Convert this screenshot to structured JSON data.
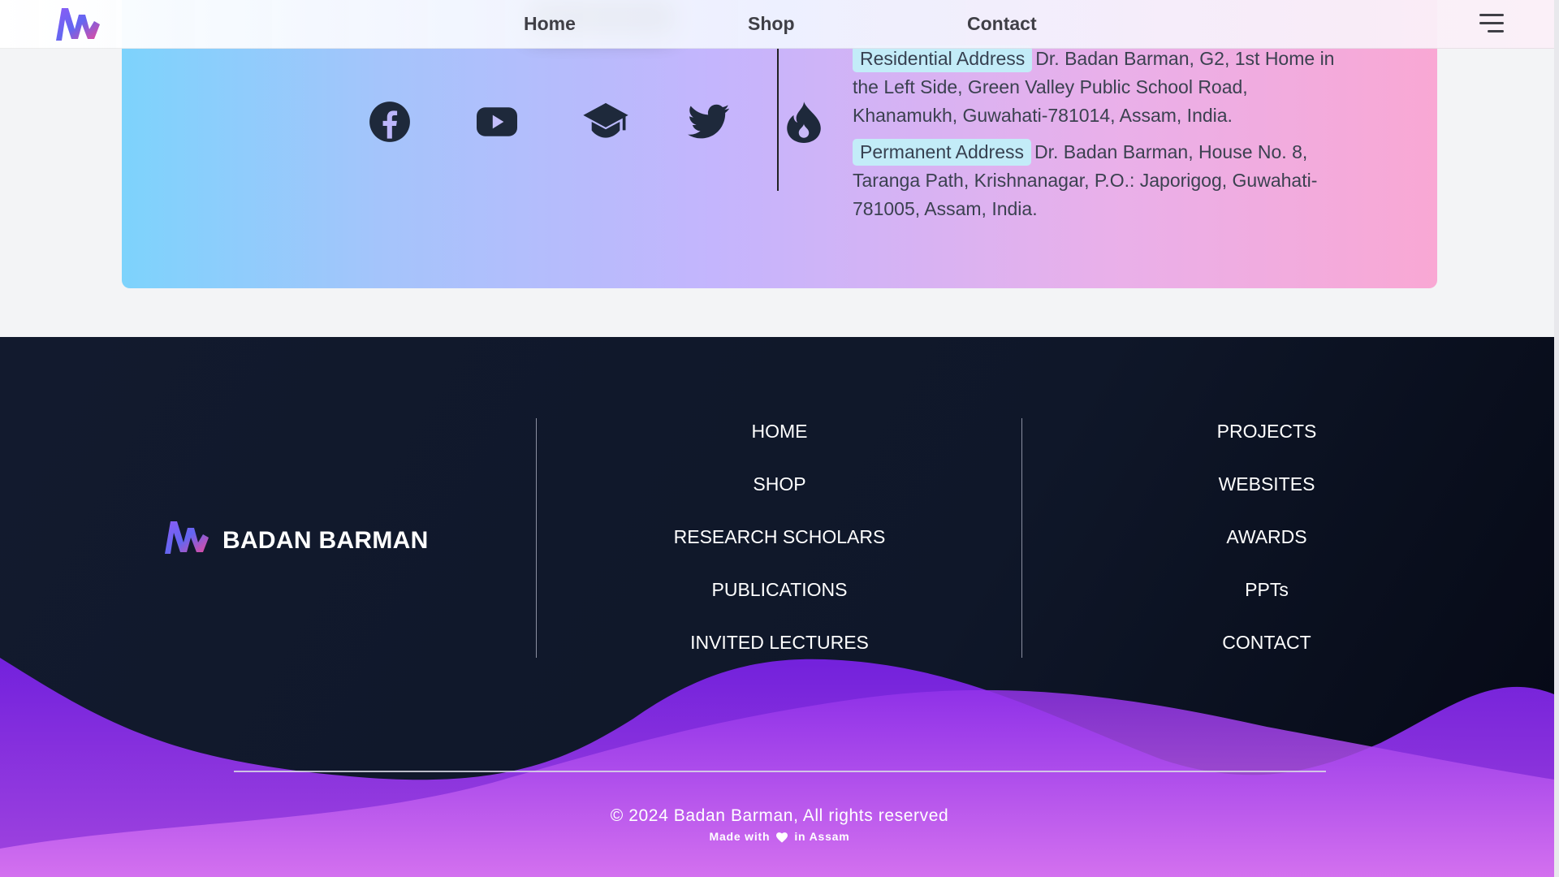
{
  "header": {
    "nav": [
      {
        "label": "Home"
      },
      {
        "label": "Shop"
      },
      {
        "label": "Contact"
      }
    ]
  },
  "contact": {
    "social": [
      {
        "icon": "facebook-icon"
      },
      {
        "icon": "youtube-icon"
      },
      {
        "icon": "graduation-cap-icon"
      },
      {
        "icon": "twitter-icon"
      },
      {
        "icon": "fire-icon"
      }
    ],
    "residential": {
      "label": "Residential Address",
      "text": "Dr. Badan Barman, G2, 1st Home in the Left Side, Green Valley Public School Road, Khanamukh, Guwahati-781014, Assam, India."
    },
    "permanent": {
      "label": "Permanent Address",
      "text": "Dr. Badan Barman, House No. 8, Taranga Path, Krishnanagar, P.O.: Japorigog, Guwahati-781005, Assam, India."
    }
  },
  "footer": {
    "brand": "BADAN BARMAN",
    "col1": [
      "HOME",
      "SHOP",
      "RESEARCH SCHOLARS",
      "PUBLICATIONS",
      "INVITED LECTURES"
    ],
    "col2": [
      "PROJECTS",
      "WEBSITES",
      "AWARDS",
      "PPTs",
      "CONTACT"
    ],
    "copyright": "© 2024 Badan Barman, All rights reserved",
    "made_with": "Made with",
    "in_place": "in Assam"
  },
  "colors": {
    "footer_bg": "#0f1729",
    "wave_purple": "#8b2cf5",
    "wave_pink": "#d570f0",
    "address_chip": "#c3ecf8"
  }
}
